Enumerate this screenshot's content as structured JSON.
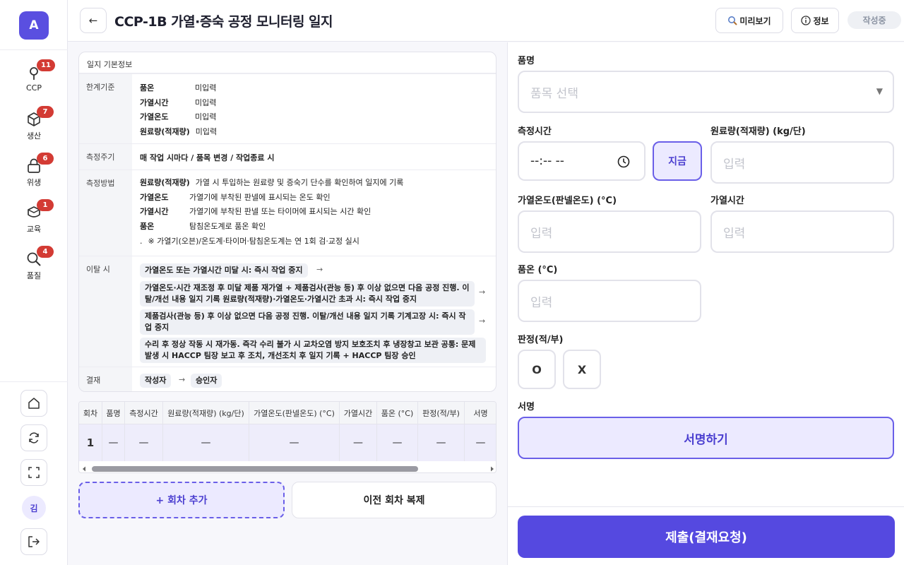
{
  "sidebar": {
    "logo": "A",
    "items": [
      {
        "label": "CCP",
        "badge": "11",
        "icon": "ccp-icon"
      },
      {
        "label": "생산",
        "badge": "7",
        "icon": "cube-icon"
      },
      {
        "label": "위생",
        "badge": "6",
        "icon": "lock-icon"
      },
      {
        "label": "교육",
        "badge": "1",
        "icon": "graduation-icon"
      },
      {
        "label": "품질",
        "badge": "4",
        "icon": "search-icon"
      }
    ],
    "user_initial": "김"
  },
  "header": {
    "back_icon": "←",
    "title": "CCP-1B 가열·증숙 공정 모니터링 일지",
    "preview_label": "미리보기",
    "info_label": "정보",
    "status": "작성중"
  },
  "info_card": {
    "title": "일지 기본정보",
    "limits": {
      "label": "한계기준",
      "items": [
        {
          "key": "품온",
          "value": "미입력"
        },
        {
          "key": "가열시간",
          "value": "미입력"
        },
        {
          "key": "가열온도",
          "value": "미입력"
        },
        {
          "key": "원료량(적재량)",
          "value": "미입력"
        }
      ]
    },
    "cycle": {
      "label": "측정주기",
      "value": "매 작업 시마다 / 품목 변경 / 작업종료 시"
    },
    "method": {
      "label": "측정방법",
      "items": [
        {
          "key": "원료량(적재량)",
          "value": "가열 시 투입하는 원료량 및 증숙기 단수를 확인하여 일지에 기록"
        },
        {
          "key": "가열온도",
          "value": "가열기에 부착된 판넬에 표시되는 온도 확인"
        },
        {
          "key": "가열시간",
          "value": "가열기에 부착된 판넬 또는 타이머에 표시되는 시간 확인"
        },
        {
          "key": "품온",
          "value": "탐침온도계로 품온 확인"
        }
      ],
      "note_prefix": ".",
      "note": "※ 가열기(오븐)/온도계·타이머·탐침온도계는 연 1회 검·교정 실시"
    },
    "deviation": {
      "label": "이탈 시",
      "steps": [
        "가열온도 또는 가열시간 미달 시: 즉시 작업 중지",
        "가열온도·시간 재조정 후 미달 제품 재가열 + 제품검사(관능 등) 후 이상 없으면 다음 공정 진행. 이탈/개선 내용 일지 기록 원료량(적재량)·가열온도·가열시간 초과 시: 즉시 작업 중지",
        "제품검사(관능 등) 후 이상 없으면 다음 공정 진행. 이탈/개선 내용 일지 기록 기계고장 시: 즉시 작업 중지",
        "수리 후 정상 작동 시 재가동. 즉각 수리 불가 시 교차오염 방지 보호조치 후 냉장창고 보관 공통: 문제 발생 시 HACCP 팀장 보고 후 조치, 개선조치 후 일지 기록 + HACCP 팀장 승인"
      ]
    },
    "approval": {
      "label": "결재",
      "writer": "작성자",
      "approver": "승인자"
    }
  },
  "table": {
    "headers": [
      "회차",
      "품명",
      "측정시간",
      "원료량(적재량) (kg/단)",
      "가열온도(판넬온도) (°C)",
      "가열시간",
      "품온 (°C)",
      "판정(적/부)",
      "서명"
    ],
    "rows": [
      [
        "1",
        "—",
        "—",
        "—",
        "—",
        "—",
        "—",
        "—",
        "—"
      ]
    ]
  },
  "actions": {
    "add_round": "+ 회차 추가",
    "copy_prev": "이전 회차 복제"
  },
  "form": {
    "product": {
      "label": "품명",
      "placeholder": "품목 선택"
    },
    "time": {
      "label": "측정시간",
      "value": "--:-- --",
      "now_label": "지금"
    },
    "amount": {
      "label": "원료량(적재량) (kg/단)",
      "placeholder": "입력"
    },
    "temp": {
      "label": "가열온도(판넬온도) (°C)",
      "placeholder": "입력"
    },
    "duration": {
      "label": "가열시간",
      "placeholder": "입력"
    },
    "core_temp": {
      "label": "품온 (°C)",
      "placeholder": "입력"
    },
    "judgment": {
      "label": "판정(적/부)",
      "ok": "O",
      "ng": "X"
    },
    "signature": {
      "label": "서명",
      "button": "서명하기"
    },
    "submit": "제출(결재요청)"
  },
  "colors": {
    "accent": "#5549e0",
    "accent_light": "#eceaff",
    "badge": "#d33b34"
  }
}
